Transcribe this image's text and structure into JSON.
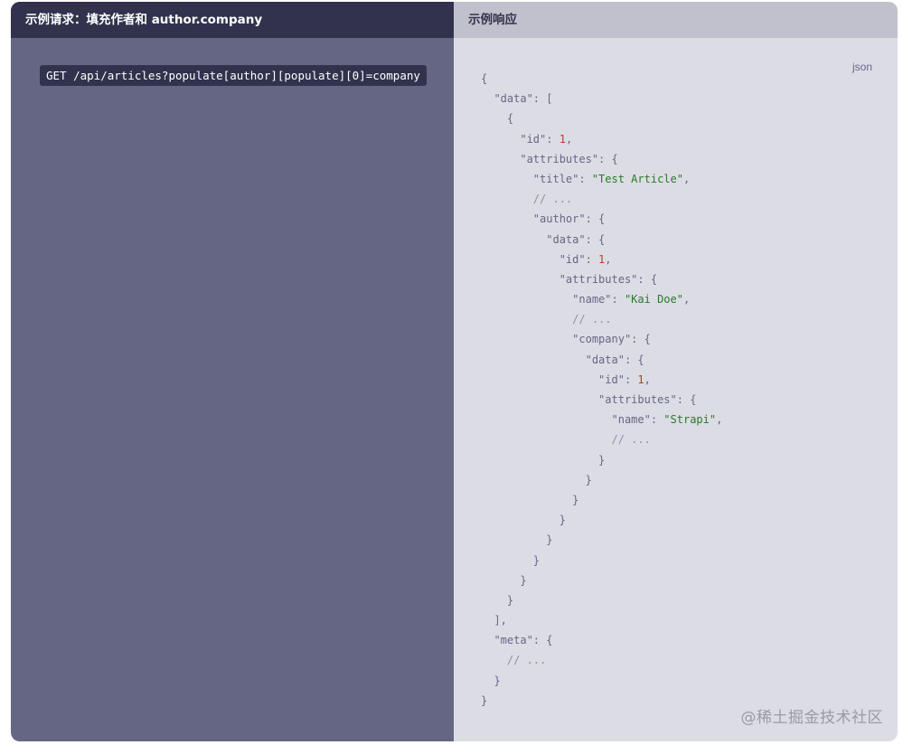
{
  "left_panel": {
    "title": "示例请求：填充作者和 author.company",
    "request": "GET /api/articles?populate[author][populate][0]=company"
  },
  "right_panel": {
    "title": "示例响应",
    "language": "json",
    "code_lines": [
      [
        [
          "punc",
          "{"
        ]
      ],
      [
        [
          "punc",
          "  \"data\": ["
        ]
      ],
      [
        [
          "punc",
          "    {"
        ]
      ],
      [
        [
          "punc",
          "      \"id\": "
        ],
        [
          "num",
          "1"
        ],
        [
          "punc",
          ","
        ]
      ],
      [
        [
          "punc",
          "      \"attributes\": {"
        ]
      ],
      [
        [
          "punc",
          "        \"title\": "
        ],
        [
          "str",
          "\"Test Article\""
        ],
        [
          "punc",
          ","
        ]
      ],
      [
        [
          "cmt",
          "        // ..."
        ]
      ],
      [
        [
          "punc",
          "        \"author\": {"
        ]
      ],
      [
        [
          "punc",
          "          \"data\": {"
        ]
      ],
      [
        [
          "punc",
          "            \"id\": "
        ],
        [
          "num",
          "1"
        ],
        [
          "punc",
          ","
        ]
      ],
      [
        [
          "punc",
          "            \"attributes\": {"
        ]
      ],
      [
        [
          "punc",
          "              \"name\": "
        ],
        [
          "str",
          "\"Kai Doe\""
        ],
        [
          "punc",
          ","
        ]
      ],
      [
        [
          "cmt",
          "              // ..."
        ]
      ],
      [
        [
          "punc",
          "              \"company\": {"
        ]
      ],
      [
        [
          "punc",
          "                \"data\": {"
        ]
      ],
      [
        [
          "punc",
          "                  \"id\": "
        ],
        [
          "num",
          "1"
        ],
        [
          "punc",
          ","
        ]
      ],
      [
        [
          "punc",
          "                  \"attributes\": {"
        ]
      ],
      [
        [
          "punc",
          "                    \"name\": "
        ],
        [
          "str",
          "\"Strapi\""
        ],
        [
          "punc",
          ","
        ]
      ],
      [
        [
          "cmt",
          "                    // ..."
        ]
      ],
      [
        [
          "punc",
          "                  }"
        ]
      ],
      [
        [
          "punc",
          "                }"
        ]
      ],
      [
        [
          "punc",
          "              }"
        ]
      ],
      [
        [
          "punc",
          "            }"
        ]
      ],
      [
        [
          "punc",
          "          }"
        ]
      ],
      [
        [
          "punc",
          "        }"
        ]
      ],
      [
        [
          "punc",
          "      }"
        ]
      ],
      [
        [
          "punc",
          "    }"
        ]
      ],
      [
        [
          "punc",
          "  ],"
        ]
      ],
      [
        [
          "punc",
          "  \"meta\": {"
        ]
      ],
      [
        [
          "cmt",
          "    // ..."
        ]
      ],
      [
        [
          "punc",
          "  }"
        ]
      ],
      [
        [
          "punc",
          "}"
        ]
      ]
    ]
  },
  "watermark": "@稀土掘金技术社区"
}
